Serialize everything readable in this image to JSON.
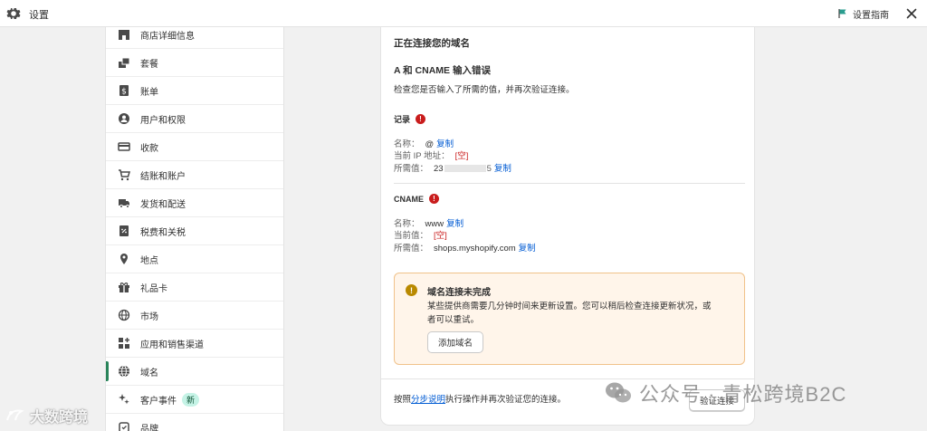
{
  "topbar": {
    "title": "设置",
    "guide_label": "设置指南"
  },
  "sidebar": {
    "items": [
      {
        "label": "商店详细信息",
        "icon": "store-icon"
      },
      {
        "label": "套餐",
        "icon": "plan-icon"
      },
      {
        "label": "账单",
        "icon": "billing-icon"
      },
      {
        "label": "用户和权限",
        "icon": "user-icon"
      },
      {
        "label": "收款",
        "icon": "payment-card-icon"
      },
      {
        "label": "结账和账户",
        "icon": "cart-icon"
      },
      {
        "label": "发货和配送",
        "icon": "truck-icon"
      },
      {
        "label": "税费和关税",
        "icon": "tax-icon"
      },
      {
        "label": "地点",
        "icon": "location-pin-icon"
      },
      {
        "label": "礼品卡",
        "icon": "gift-icon"
      },
      {
        "label": "市场",
        "icon": "globe-icon"
      },
      {
        "label": "应用和销售渠道",
        "icon": "apps-icon"
      },
      {
        "label": "域名",
        "icon": "domain-globe-icon"
      },
      {
        "label": "客户事件",
        "icon": "sparkle-icon",
        "badge": "新"
      },
      {
        "label": "品牌",
        "icon": "brand-icon"
      }
    ],
    "active": "域名"
  },
  "main": {
    "heading": "正在连接您的域名",
    "error_title": "A 和 CNAME 输入错误",
    "error_desc": "检查您是否输入了所需的值，并再次验证连接。",
    "records": {
      "head": "记录",
      "name_label": "名称：",
      "name_value": "@",
      "copy": "复制",
      "current_ip_label": "当前 IP 地址：",
      "current_ip_value": "[空]",
      "required_label": "所需值：",
      "required_value_start": "23",
      "required_value_end": "5"
    },
    "cname": {
      "head": "CNAME",
      "name_label": "名称：",
      "name_value": "www",
      "copy": "复制",
      "current_label": "当前值：",
      "current_value": "[空]",
      "required_label": "所需值：",
      "required_value": "shops.myshopify.com"
    },
    "warning": {
      "title": "域名连接未完成",
      "desc": "某些提供商需要几分钟时间来更新设置。您可以稍后检查连接更新状况，或者可以重试。",
      "button": "添加域名"
    },
    "footer": {
      "prefix": "按照",
      "link": "分步说明",
      "suffix": "执行操作并再次验证您的连接。",
      "verify_button": "验证连接"
    }
  },
  "watermarks": {
    "right": "公众号 · 青松跨境B2C",
    "left": "大数跨境"
  },
  "colors": {
    "accent": "#29845a",
    "error": "#c91c1c",
    "link": "#005bd3",
    "warning_bg": "#fff5ea"
  }
}
